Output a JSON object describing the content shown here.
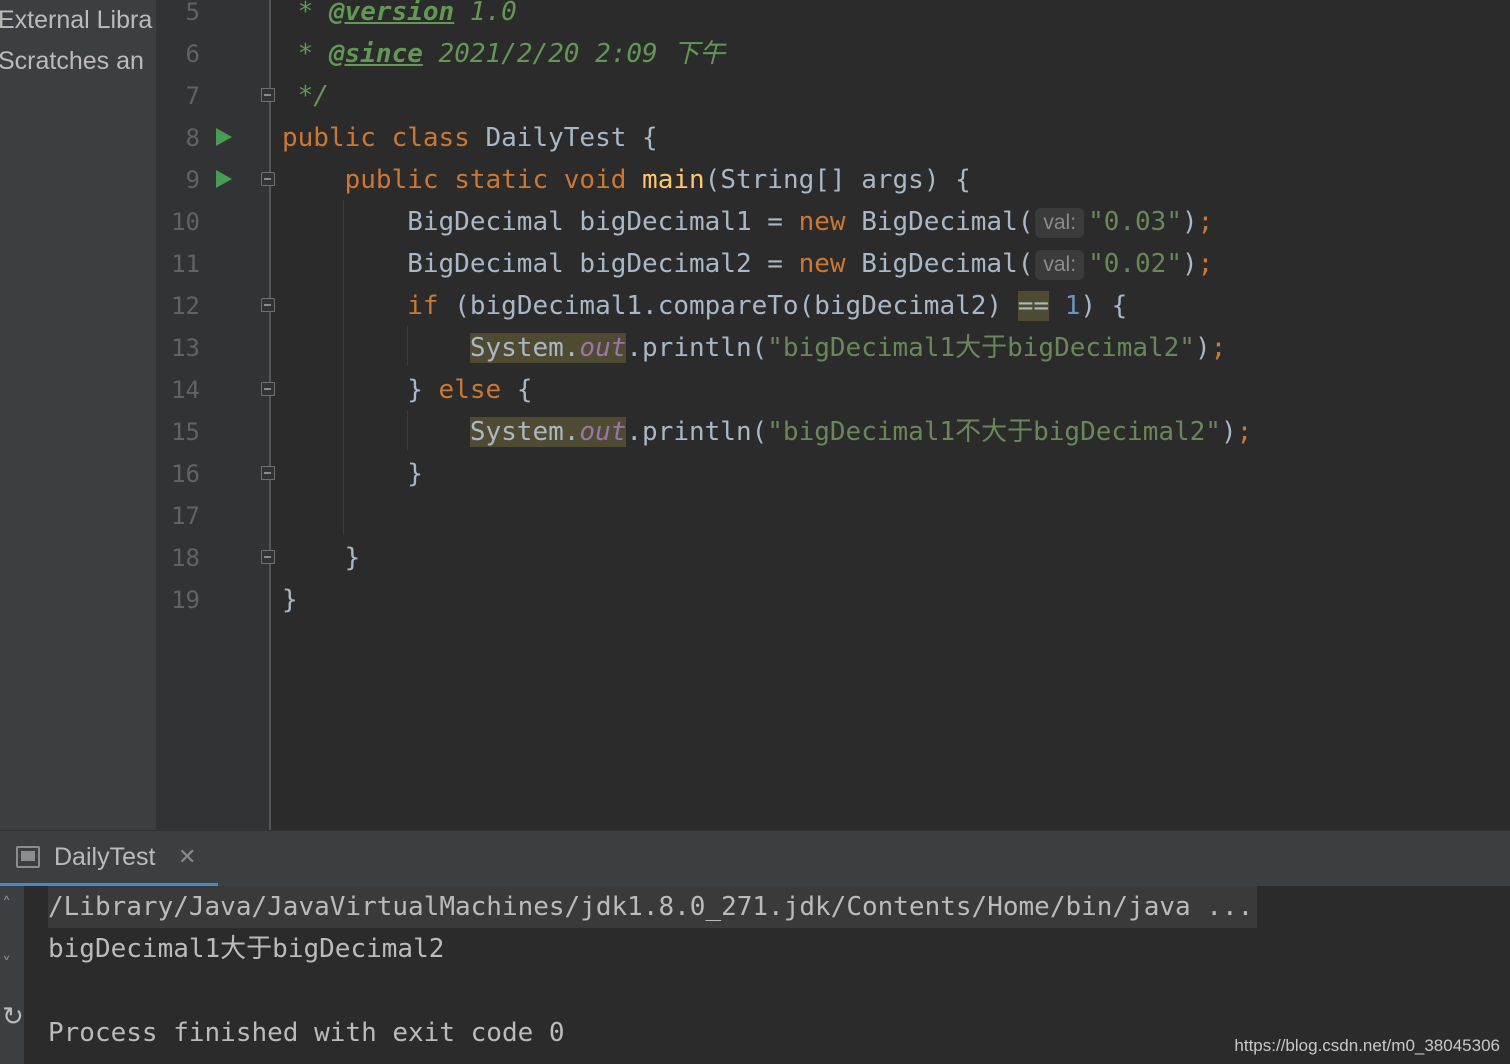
{
  "project_tree": {
    "items": [
      "External Libra",
      "Scratches an"
    ]
  },
  "editor": {
    "line_numbers": [
      "5",
      "6",
      "7",
      "8",
      "9",
      "10",
      "11",
      "12",
      "13",
      "14",
      "15",
      "16",
      "17",
      "18",
      "19"
    ],
    "version_label": "* @version 1.0",
    "since_date": "2021/2/20 2:09 下午",
    "comment_end": "*/",
    "class_name": "DailyTest",
    "hint_label": "val:",
    "string_a": "\"0.03\"",
    "string_b": "\"0.02\"",
    "msg_greater": "\"bigDecimal1大于bigDecimal2\"",
    "msg_not_greater": "\"bigDecimal1不大于bigDecimal2\""
  },
  "run_panel": {
    "tab_label": "DailyTest",
    "console_lines": [
      "/Library/Java/JavaVirtualMachines/jdk1.8.0_271.jdk/Contents/Home/bin/java ...",
      "bigDecimal1大于bigDecimal2",
      "",
      "Process finished with exit code 0"
    ]
  },
  "watermark": "https://blog.csdn.net/m0_38045306",
  "colors": {
    "background": "#2b2b2b",
    "keyword": "#cc7832",
    "string": "#6a8759",
    "number": "#6897bb",
    "method": "#ffc66d",
    "field": "#9876aa",
    "run_arrow": "#499c54"
  }
}
